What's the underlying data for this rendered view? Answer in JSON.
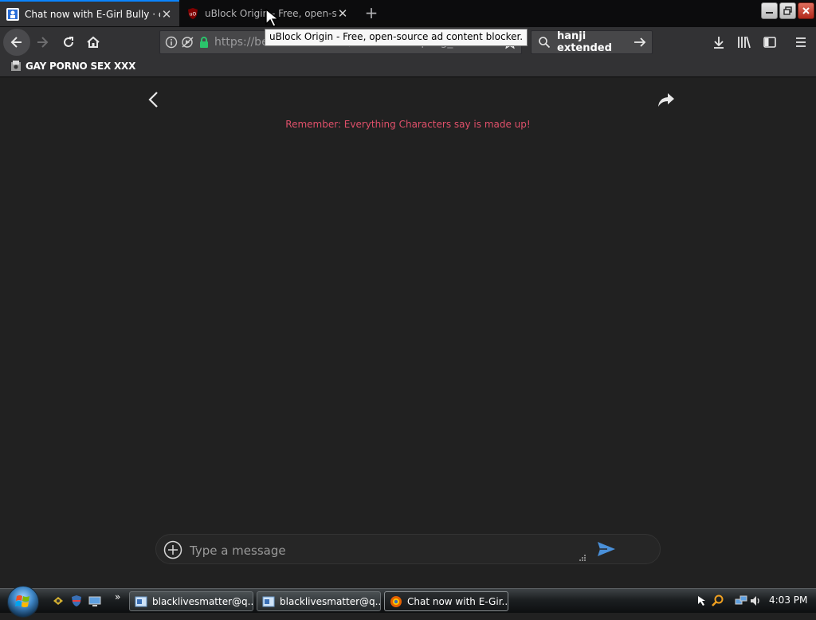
{
  "tabs": [
    {
      "title": "Chat now with E-Girl Bully · cre",
      "active": true
    },
    {
      "title": "uBlock Origin - Free, open-so",
      "active": false
    }
  ],
  "tooltip": "uBlock Origin - Free, open-source ad content blocker.",
  "navbar": {
    "url": "https://beta.character.ai/chat?char=qwbg_3cd...",
    "search_value": "hanji extended"
  },
  "bookmarks": [
    {
      "label": "GAY PORNO SEX XXX"
    }
  ],
  "page": {
    "disclaimer": "Remember: Everything Characters say is made up!",
    "disclaimer_color": "#e0506a",
    "message_placeholder": "Type a message"
  },
  "taskbar": {
    "buttons": [
      {
        "label": "blacklivesmatter@q..."
      },
      {
        "label": "blacklivesmatter@q..."
      },
      {
        "label": "Chat now with E-Gir..."
      }
    ],
    "clock": "4:03 PM"
  },
  "colors": {
    "accent": "#0a84ff",
    "send_icon": "#4a90d9",
    "page_bg": "#212121"
  }
}
